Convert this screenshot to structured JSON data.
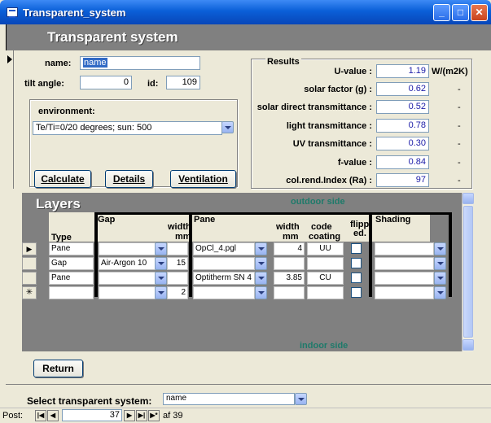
{
  "window": {
    "title": "Transparent_system"
  },
  "form": {
    "header": "Transparent system"
  },
  "fields": {
    "name_label": "name:",
    "name_value": "name",
    "tilt_label": "tilt angle:",
    "tilt_value": "0",
    "id_label": "id:",
    "id_value": "109"
  },
  "environment": {
    "label": "environment:",
    "value": "Te/Ti=0/20 degrees; sun: 500"
  },
  "buttons": {
    "calculate": "Calculate",
    "details": "Details",
    "ventilation": "Ventilation",
    "return": "Return"
  },
  "results": {
    "title": "Results",
    "rows": [
      {
        "label": "U-value :",
        "value": "1.19",
        "unit": "W/(m2K)"
      },
      {
        "label": "solar factor (g) :",
        "value": "0.62",
        "unit": "-"
      },
      {
        "label": "solar direct transmittance :",
        "value": "0.52",
        "unit": "-"
      },
      {
        "label": "light  transmittance :",
        "value": "0.78",
        "unit": "-"
      },
      {
        "label": "UV transmittance :",
        "value": "0.30",
        "unit": "-"
      },
      {
        "label": "f-value :",
        "value": "0.84",
        "unit": "-"
      },
      {
        "label": "col.rend.Index (Ra) :",
        "value": "97",
        "unit": "-"
      }
    ]
  },
  "layers": {
    "title": "Layers",
    "outdoor": "outdoor side",
    "indoor": "indoor side",
    "headers": {
      "type": "Type",
      "gap": "Gap",
      "width1_a": "width",
      "width1_b": "mm",
      "pane": "Pane",
      "width2_a": "width",
      "width2_b": "mm",
      "code_a": "code",
      "code_b": "coating",
      "flip_a": "flipp",
      "flip_b": "ed.",
      "shading": "Shading"
    },
    "rows": [
      {
        "type": "Pane",
        "gap": "",
        "gap_width": "",
        "pane": "OpCl_4.pgl",
        "pane_width": "4",
        "code": "UU",
        "shading": ""
      },
      {
        "type": "Gap",
        "gap": "Air-Argon 10",
        "gap_width": "15",
        "pane": "",
        "pane_width": "",
        "code": "",
        "shading": ""
      },
      {
        "type": "Pane",
        "gap": "",
        "gap_width": "",
        "pane": "Optitherm SN 4",
        "pane_width": "3.85",
        "code": "CU",
        "shading": ""
      },
      {
        "type": "",
        "gap": "",
        "gap_width": "2",
        "pane": "",
        "pane_width": "",
        "code": "",
        "shading": ""
      }
    ]
  },
  "footer": {
    "select_label": "Select transparent system:",
    "select_value": "name"
  },
  "nav": {
    "label": "Post:",
    "record": "37",
    "total": "af 39"
  }
}
